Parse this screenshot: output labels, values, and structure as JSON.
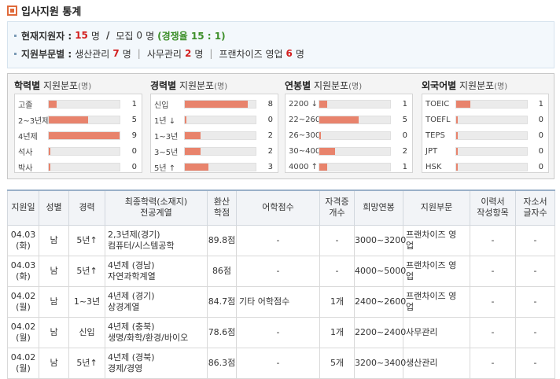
{
  "page": {
    "title": "입사지원 통계"
  },
  "summary": {
    "current_label": "현재지원자 :",
    "current_count": "15",
    "unit": "명",
    "slash": "/",
    "recruit_label": "모집",
    "recruit_count": "0",
    "ratio_text": "(경쟁율 15 : 1)",
    "dept_label": "지원부문별 :",
    "depts": [
      {
        "name": "생산관리",
        "count": "7",
        "unit": "명"
      },
      {
        "name": "사무관리",
        "count": "2",
        "unit": "명"
      },
      {
        "name": "프랜차이즈 영업",
        "count": "6",
        "unit": "명"
      }
    ],
    "separator": "|"
  },
  "distribution": {
    "unit_label": "(명)",
    "bar_color": "#e8836c",
    "panels": [
      {
        "title_strong": "학력별",
        "title_rest": "지원분포",
        "max": 9,
        "rows": [
          {
            "label": "고졸",
            "value": 1
          },
          {
            "label": "2~3년제",
            "value": 5
          },
          {
            "label": "4년제",
            "value": 9
          },
          {
            "label": "석사",
            "value": 0
          },
          {
            "label": "박사",
            "value": 0
          }
        ]
      },
      {
        "title_strong": "경력별",
        "title_rest": "지원분포",
        "max": 9,
        "rows": [
          {
            "label": "신입",
            "value": 8
          },
          {
            "label": "1년 ↓",
            "value": 0
          },
          {
            "label": "1~3년",
            "value": 2
          },
          {
            "label": "3~5년",
            "value": 2
          },
          {
            "label": "5년 ↑",
            "value": 3
          }
        ]
      },
      {
        "title_strong": "연봉별",
        "title_rest": "지원분포",
        "max": 9,
        "rows": [
          {
            "label": "2200 ↓",
            "value": 1
          },
          {
            "label": "22~2600",
            "value": 5
          },
          {
            "label": "26~3000",
            "value": 0
          },
          {
            "label": "30~4000",
            "value": 2
          },
          {
            "label": "4000 ↑",
            "value": 1
          }
        ]
      },
      {
        "title_strong": "외국어별",
        "title_rest": "지원분포",
        "max": 5,
        "rows": [
          {
            "label": "TOEIC",
            "value": 1
          },
          {
            "label": "TOEFL",
            "value": 0
          },
          {
            "label": "TEPS",
            "value": 0
          },
          {
            "label": "JPT",
            "value": 0
          },
          {
            "label": "HSK",
            "value": 0
          }
        ]
      }
    ]
  },
  "table": {
    "headers": [
      "지원일",
      "성별",
      "경력",
      "최종학력(소재지)\n전공계열",
      "환산\n학점",
      "어학점수",
      "자격증\n개수",
      "희망연봉",
      "지원부문",
      "이력서\n작성항목",
      "자소서\n글자수"
    ],
    "rows": [
      [
        "04.03\n(화)",
        "남",
        "5년↑",
        "2,3년제(경기)\n컴퓨터/시스템공학",
        "89.8점",
        "-",
        "-",
        "3000~3200",
        "프랜차이즈 영\n업",
        "-",
        "-"
      ],
      [
        "04.03\n(화)",
        "남",
        "5년↑",
        "4년제 (경남)\n자연과학계열",
        "86점",
        "-",
        "-",
        "4000~5000",
        "프랜차이즈 영\n업",
        "-",
        "-"
      ],
      [
        "04.02\n(월)",
        "남",
        "1~3년",
        "4년제 (경기)\n상경계열",
        "84.7점",
        "기타 어학점수",
        "1개",
        "2400~2600",
        "프랜차이즈 영\n업",
        "-",
        "-"
      ],
      [
        "04.02\n(월)",
        "남",
        "신입",
        "4년제 (충북)\n생명/화학/환경/바이오",
        "78.6점",
        "-",
        "1개",
        "2200~2400",
        "사무관리",
        "-",
        "-"
      ],
      [
        "04.02\n(월)",
        "남",
        "5년↑",
        "4년제 (경북)\n경제/경영",
        "86.3점",
        "-",
        "5개",
        "3200~3400",
        "생산관리",
        "-",
        "-"
      ]
    ]
  }
}
